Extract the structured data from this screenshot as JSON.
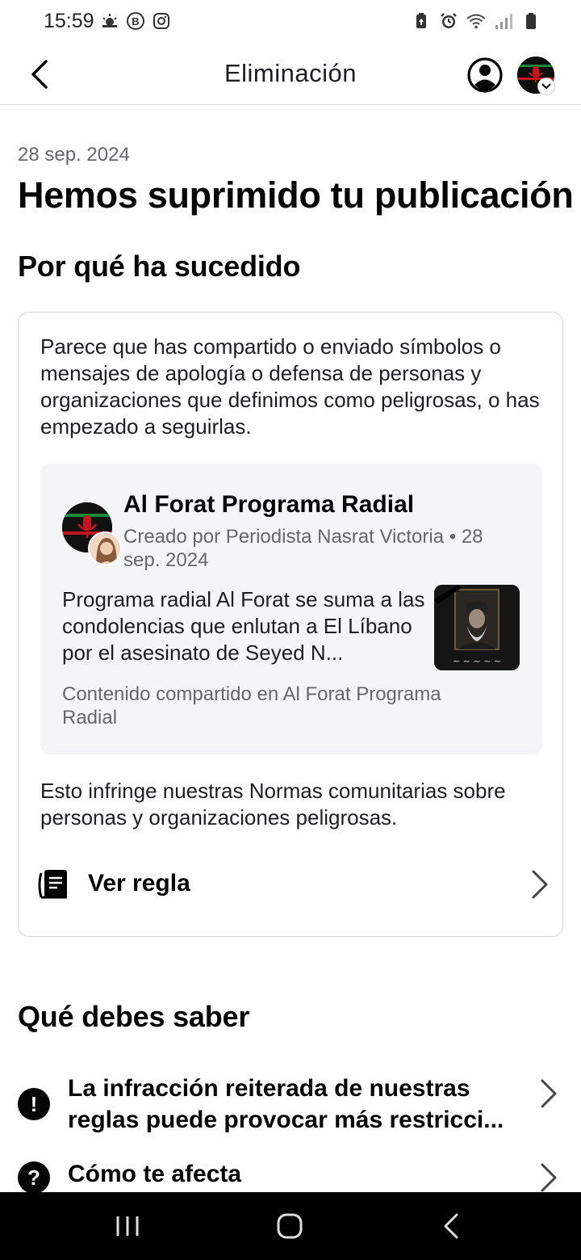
{
  "status_bar": {
    "time": "15:59",
    "left_icons": [
      "weather-icon",
      "b-icon",
      "instagram-icon"
    ],
    "right_icons": [
      "battery-saver-icon",
      "alarm-icon",
      "wifi-icon",
      "signal-icon",
      "battery-icon"
    ]
  },
  "app_bar": {
    "title": "Eliminación"
  },
  "content": {
    "date": "28 sep. 2024",
    "title": "Hemos suprimido tu publicación",
    "why_title": "Por qué ha sucedido",
    "reason_text": "Parece que has compartido o enviado símbolos o mensajes de apología o defensa de personas y organizaciones que definimos como peligrosas, o has empezado a seguirlas.",
    "post": {
      "page_name": "Al Forat Programa Radial",
      "meta": "Creado por Periodista Nasrat Victoria • 28 sep. 2024",
      "body": "Programa radial Al Forat se suma a las condolencias que enlutan a El Líbano por el asesinato de Seyed N...",
      "footer": "Contenido compartido en Al Forat Programa Radial"
    },
    "rule_text": "Esto infringe nuestras Normas comunitarias sobre personas y organizaciones peligrosas.",
    "rule_link": "Ver regla",
    "know_title": "Qué debes saber",
    "know_items": [
      {
        "icon": "exclamation-icon",
        "symbol": "!",
        "label": "La infracción reiterada de nuestras reglas puede provocar más restricci..."
      },
      {
        "icon": "question-icon",
        "symbol": "?",
        "label": "Cómo te afecta"
      }
    ]
  },
  "colors": {
    "text_primary": "#050505",
    "text_secondary": "#65676b",
    "card_border": "#d4d6da",
    "post_bg": "#f4f5f7",
    "nav_bar": "#000000"
  }
}
